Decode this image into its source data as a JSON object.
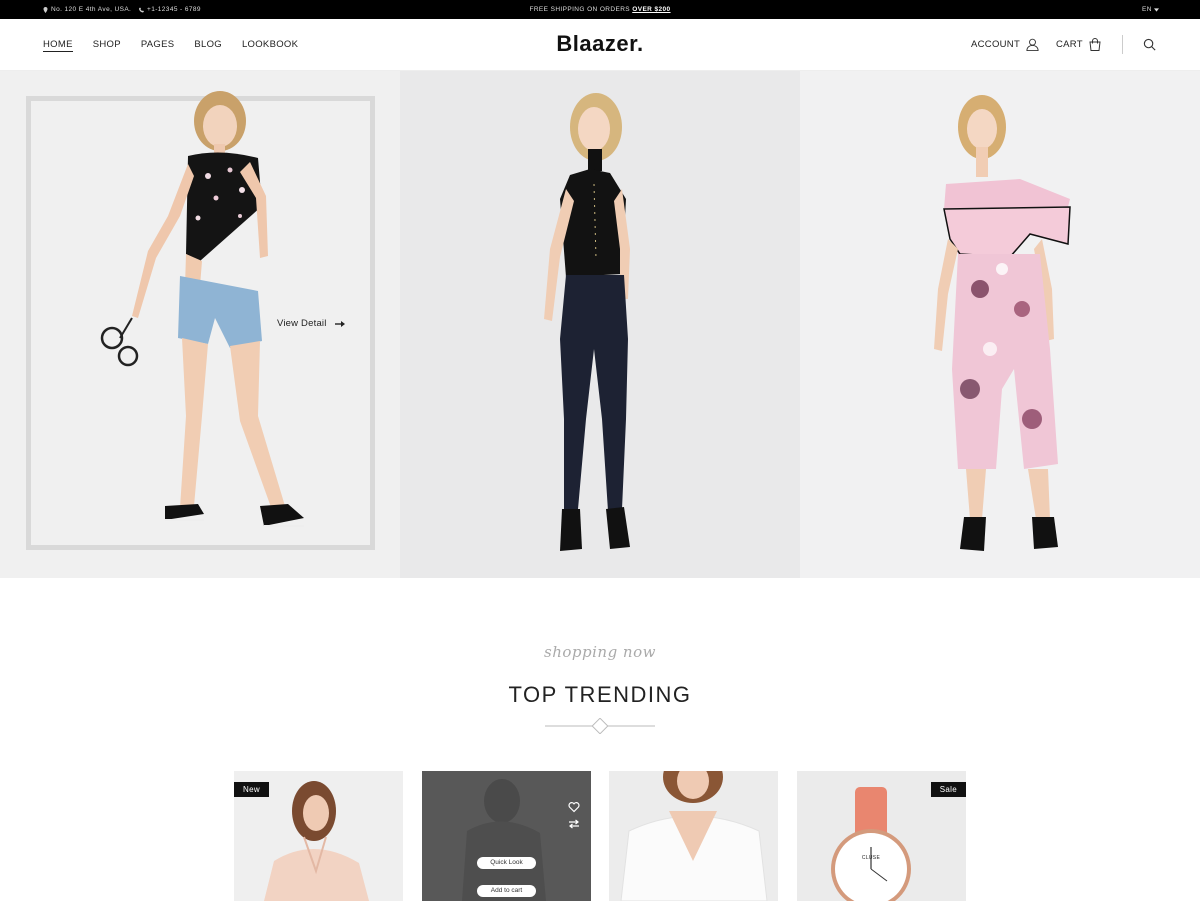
{
  "topbar": {
    "address": "No. 120 E 4th Ave, USA.",
    "phone": "+1-12345 - 6789",
    "shipping_text": "FREE SHIPPING ON ORDERS",
    "shipping_highlight": "OVER $200",
    "language": "EN"
  },
  "header": {
    "logo": "Blaazer.",
    "nav": [
      "HOME",
      "SHOP",
      "PAGES",
      "BLOG",
      "LOOKBOOK"
    ],
    "account_label": "ACCOUNT",
    "cart_label": "CART"
  },
  "hero": {
    "view_detail": "View Detail"
  },
  "section": {
    "subtitle": "shopping now",
    "title": "TOP TRENDING"
  },
  "products": {
    "badge_new": "New",
    "badge_sale": "Sale",
    "quick_look": "Quick Look",
    "add_to_cart": "Add to cart",
    "watch_brand": "CLUSE"
  },
  "colors": {
    "topbar_bg": "#000000",
    "accent": "#111111",
    "watch_strap": "#e9866f"
  }
}
